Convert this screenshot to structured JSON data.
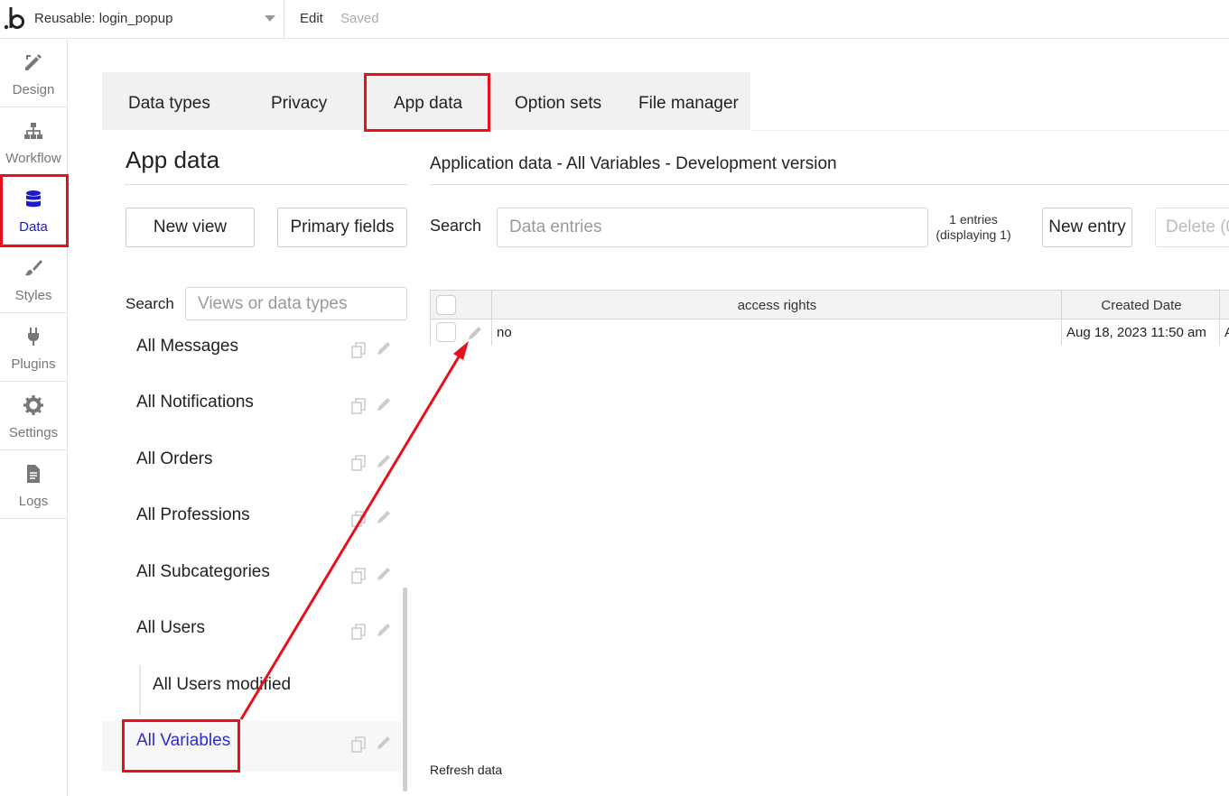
{
  "topbar": {
    "page_name": "Reusable: login_popup",
    "edit_label": "Edit",
    "saved_label": "Saved"
  },
  "sidebar": {
    "items": [
      {
        "label": "Design",
        "icon": "design-icon"
      },
      {
        "label": "Workflow",
        "icon": "workflow-icon"
      },
      {
        "label": "Data",
        "icon": "database-icon",
        "active": true
      },
      {
        "label": "Styles",
        "icon": "brush-icon"
      },
      {
        "label": "Plugins",
        "icon": "plug-icon"
      },
      {
        "label": "Settings",
        "icon": "gear-icon"
      },
      {
        "label": "Logs",
        "icon": "document-icon"
      }
    ]
  },
  "tabs": [
    "Data types",
    "Privacy",
    "App data",
    "Option sets",
    "File manager"
  ],
  "left_panel": {
    "title": "App data",
    "new_view_label": "New view",
    "primary_fields_label": "Primary fields",
    "search_label": "Search",
    "search_placeholder": "Views or data types",
    "items": [
      {
        "name": "All Messages"
      },
      {
        "name": "All Notifications"
      },
      {
        "name": "All Orders"
      },
      {
        "name": "All Professions"
      },
      {
        "name": "All Subcategories"
      },
      {
        "name": "All Users"
      },
      {
        "name": "All Users modified",
        "sub": true
      },
      {
        "name": "All Variables",
        "active": true
      }
    ]
  },
  "right_panel": {
    "title": "Application data - All Variables - Development version",
    "search_label": "Search",
    "search_placeholder": "Data entries",
    "entries_line1": "1 entries",
    "entries_line2": "(displaying 1)",
    "new_entry_label": "New entry",
    "delete_label": "Delete (0",
    "table": {
      "columns": [
        "access rights",
        "Created Date"
      ],
      "rows": [
        {
          "access_rights": "no",
          "created_date": "Aug 18, 2023 11:50 am",
          "overflow": "A"
        }
      ]
    },
    "refresh_label": "Refresh data"
  },
  "colors": {
    "highlight": "#e8101a",
    "active_nav": "#1b1bc9",
    "tabs_bg": "#f1f1f1"
  }
}
